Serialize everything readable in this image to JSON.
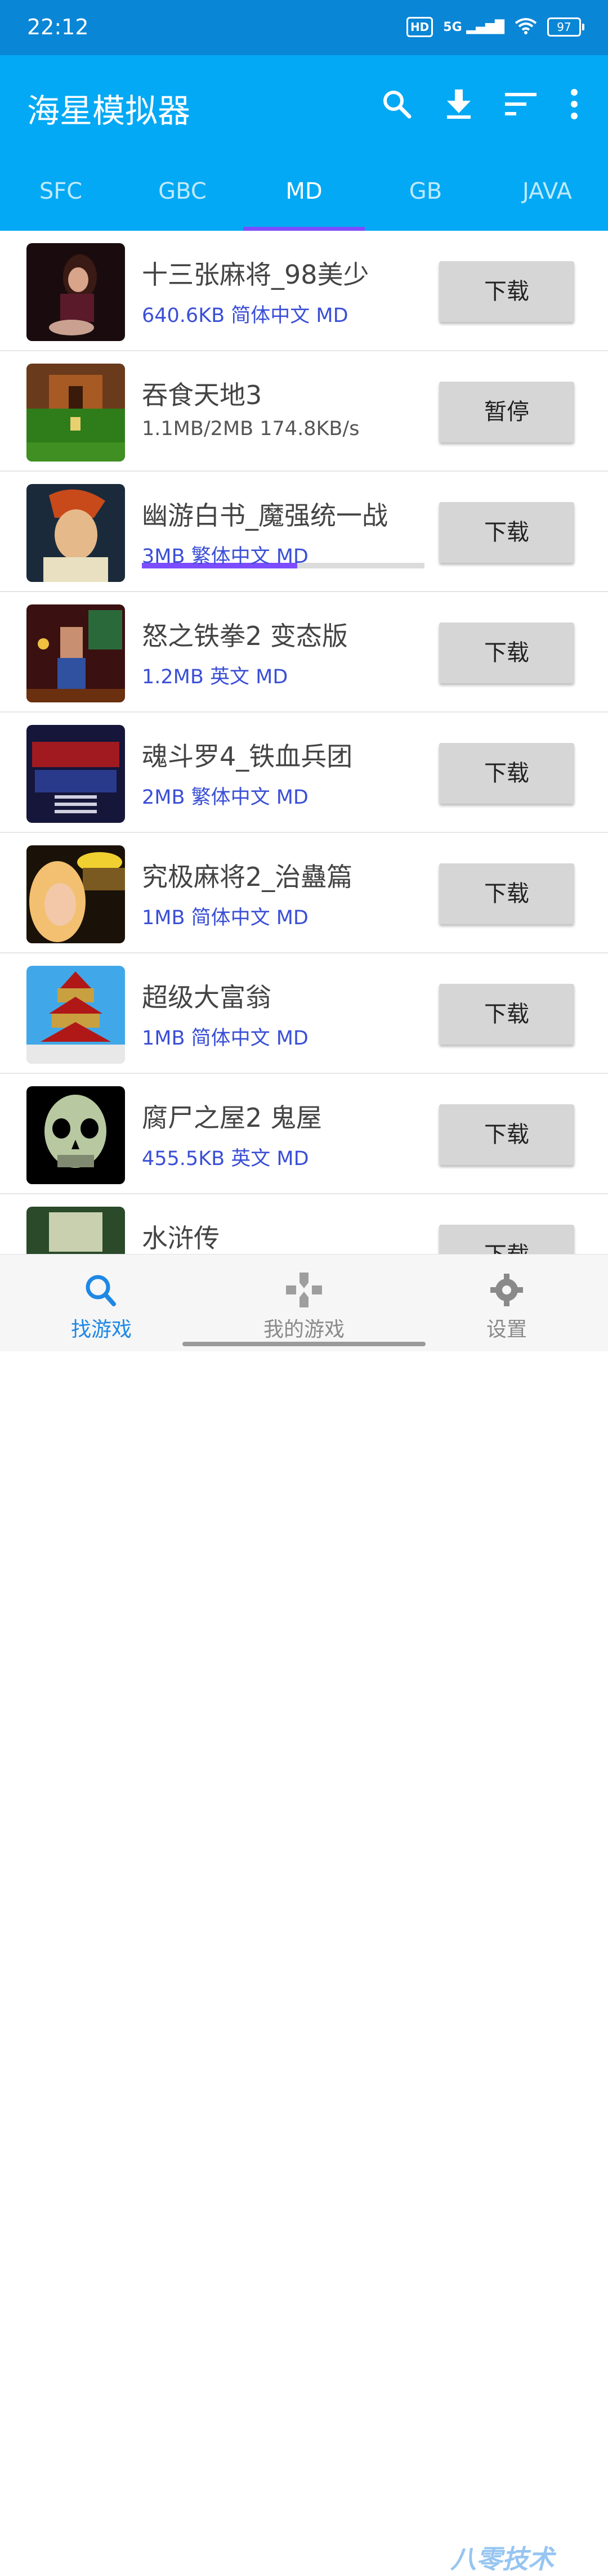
{
  "status_bar": {
    "time": "22:12",
    "hd": "HD",
    "network": "5G",
    "battery": "97"
  },
  "app": {
    "title": "海星模拟器"
  },
  "toolbar": {
    "icons": [
      "search-icon",
      "download-icon",
      "sort-icon",
      "more-icon"
    ]
  },
  "tabs": [
    {
      "label": "SFC"
    },
    {
      "label": "GBC"
    },
    {
      "label": "MD",
      "active": true
    },
    {
      "label": "GB"
    },
    {
      "label": "JAVA"
    }
  ],
  "games": [
    {
      "name": "十三张麻将_98美少",
      "meta": "640.6KB 简体中文 MD",
      "action": "下载"
    },
    {
      "name": "吞食天地3",
      "progress_text": "1.1MB/2MB  174.8KB/s",
      "progress": 0.55,
      "action": "暂停"
    },
    {
      "name": "幽游白书_魔强统一战",
      "meta": "3MB 繁体中文 MD",
      "action": "下载"
    },
    {
      "name": "怒之铁拳2 变态版",
      "meta": "1.2MB 英文 MD",
      "action": "下载"
    },
    {
      "name": "魂斗罗4_铁血兵团",
      "meta": "2MB 繁体中文 MD",
      "action": "下载"
    },
    {
      "name": "究极麻将2_治蠱篇",
      "meta": "1MB 简体中文 MD",
      "action": "下载"
    },
    {
      "name": "超级大富翁",
      "meta": "1MB 简体中文 MD",
      "action": "下载"
    },
    {
      "name": "腐尸之屋2 鬼屋",
      "meta": "455.5KB 英文 MD",
      "action": "下载"
    },
    {
      "name": "水浒传",
      "action": "下载"
    }
  ],
  "bottom_nav": [
    {
      "label": "找游戏",
      "icon": "search-icon",
      "active": true
    },
    {
      "label": "我的游戏",
      "icon": "gamepad-icon"
    },
    {
      "label": "设置",
      "icon": "gear-icon"
    }
  ],
  "watermark": "八零技术",
  "colors": {
    "app_bar": "#03a9f4",
    "status_bar": "#0a86d6",
    "tab_indicator": "#7c4dff",
    "meta_text": "#3a4fd6"
  }
}
